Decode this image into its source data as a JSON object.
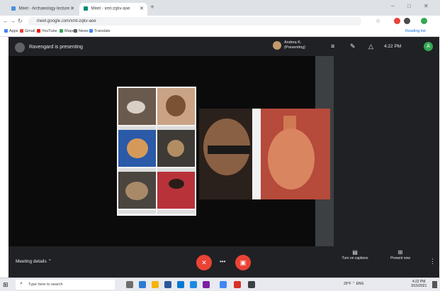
{
  "browser": {
    "tabs": [
      {
        "label": "Meet - Archaeology lecture",
        "active": false
      },
      {
        "label": "Meet - xmt-zqkv-aoe",
        "active": true
      }
    ],
    "new_tab_symbol": "+",
    "window_controls": [
      "–",
      "□",
      "✕"
    ],
    "url": "meet.google.com/xmt-zqkv-aoe",
    "bookmarks": [
      "Apps",
      "Gmail",
      "YouTube",
      "Maps",
      "News",
      "Translate"
    ],
    "reading_list": "Reading list"
  },
  "meet": {
    "presenter_banner": "Ravengard is presenting",
    "presenting_user": {
      "name": "Andrea K.",
      "subtitle": "(Presenting)"
    },
    "clock": "4:22 PM",
    "self_initial": "A",
    "bottom": {
      "meeting_details": "Meeting details",
      "right_controls": [
        "Turn on captions",
        "Present now"
      ],
      "more_symbol": "⋮"
    }
  },
  "taskbar": {
    "search_placeholder": "Type here to search",
    "clock_time": "4:22 PM",
    "clock_date": "3/15/2021",
    "tray_text": "29°F  ⌃  ENG"
  },
  "colors": {
    "meet_bg": "#202124",
    "end_call": "#ea4335",
    "accent_green": "#34a853"
  }
}
